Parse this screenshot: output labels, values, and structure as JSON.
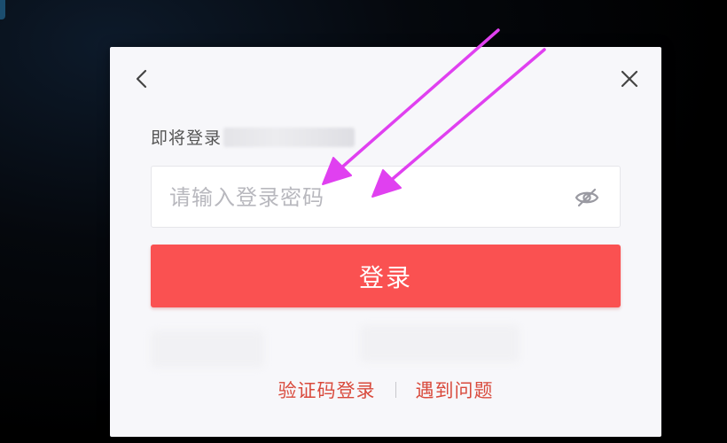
{
  "dialog": {
    "back_icon": "chevron-left-icon",
    "close_icon": "close-icon",
    "subtitle": "即将登录",
    "password": {
      "placeholder": "请输入登录密码",
      "value": "",
      "toggle_icon": "eye-off-icon"
    },
    "login_label": "登录",
    "links": {
      "sms_login": "验证码登录",
      "help": "遇到问题"
    }
  },
  "colors": {
    "accent": "#fa5151",
    "link": "#d94a3c",
    "annotation_arrow": "#e040f0"
  }
}
